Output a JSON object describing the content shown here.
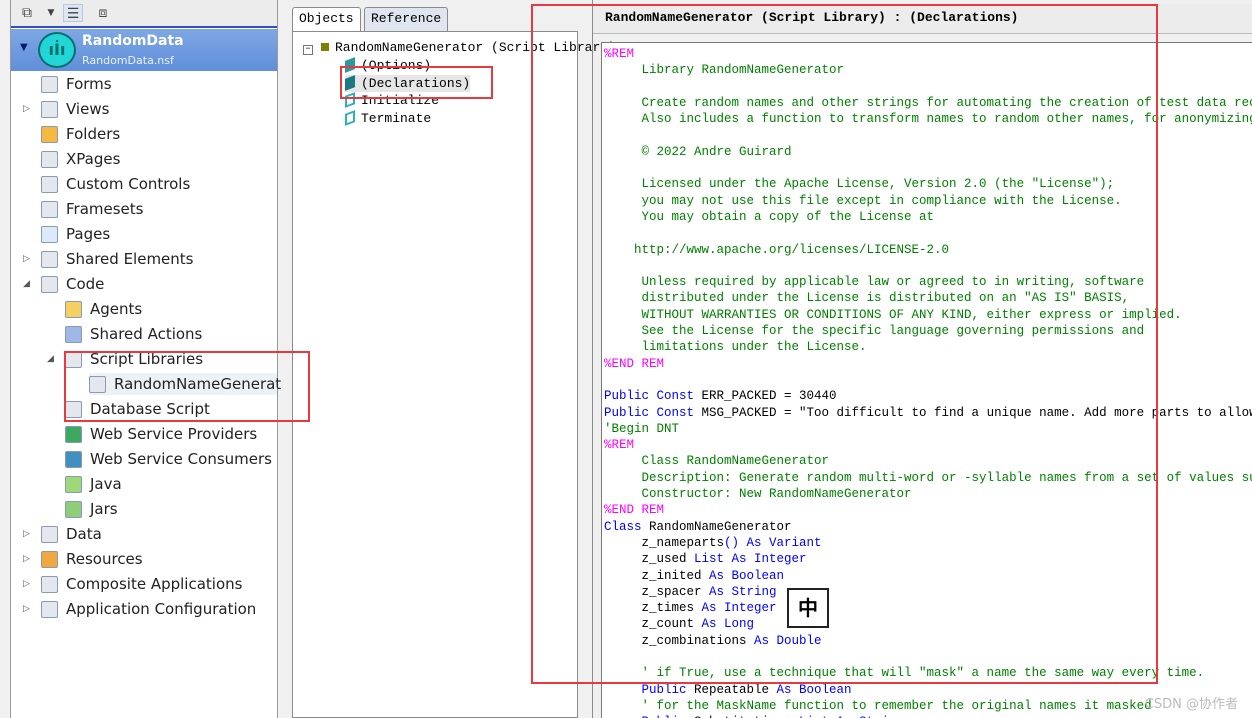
{
  "colors": {
    "comment": "#008000",
    "directive": "#ff00ff",
    "keyword": "#0000ff",
    "text": "#000000",
    "accent": "#e8393f"
  },
  "nav": {
    "toolbar_icons": [
      "new-design-element-icon",
      "dropdown-icon",
      "tree-view-icon",
      "window-icon"
    ],
    "db": {
      "title": "RandomData",
      "file": "RandomData.nsf"
    },
    "items": [
      {
        "label": "Forms",
        "icon": "forms-icon",
        "level": 1,
        "tw": ""
      },
      {
        "label": "Views",
        "icon": "views-icon",
        "level": 1,
        "tw": "▷"
      },
      {
        "label": "Folders",
        "icon": "folder-icon",
        "level": 1,
        "tw": ""
      },
      {
        "label": "XPages",
        "icon": "xpages-icon",
        "level": 1,
        "tw": ""
      },
      {
        "label": "Custom Controls",
        "icon": "custom-controls-icon",
        "level": 1,
        "tw": ""
      },
      {
        "label": "Framesets",
        "icon": "framesets-icon",
        "level": 1,
        "tw": ""
      },
      {
        "label": "Pages",
        "icon": "pages-icon",
        "level": 1,
        "tw": ""
      },
      {
        "label": "Shared Elements",
        "icon": "shared-elements-icon",
        "level": 1,
        "tw": "▷"
      },
      {
        "label": "Code",
        "icon": "code-icon",
        "level": 1,
        "tw": "◢"
      },
      {
        "label": "Agents",
        "icon": "agents-icon",
        "level": 2,
        "tw": ""
      },
      {
        "label": "Shared Actions",
        "icon": "shared-actions-icon",
        "level": 2,
        "tw": ""
      },
      {
        "label": "Script Libraries",
        "icon": "script-libraries-icon",
        "level": 2,
        "tw": "◢"
      },
      {
        "label": "RandomNameGenerat",
        "icon": "script-icon",
        "level": 3,
        "tw": "",
        "selected": true
      },
      {
        "label": "Database Script",
        "icon": "database-script-icon",
        "level": 2,
        "tw": ""
      },
      {
        "label": "Web Service Providers",
        "icon": "web-service-providers-icon",
        "level": 2,
        "tw": ""
      },
      {
        "label": "Web Service Consumers",
        "icon": "web-service-consumers-icon",
        "level": 2,
        "tw": ""
      },
      {
        "label": "Java",
        "icon": "java-icon",
        "level": 2,
        "tw": ""
      },
      {
        "label": "Jars",
        "icon": "jars-icon",
        "level": 2,
        "tw": ""
      },
      {
        "label": "Data",
        "icon": "data-icon",
        "level": 1,
        "tw": "▷"
      },
      {
        "label": "Resources",
        "icon": "resources-icon",
        "level": 1,
        "tw": "▷"
      },
      {
        "label": "Composite Applications",
        "icon": "composite-applications-icon",
        "level": 1,
        "tw": "▷"
      },
      {
        "label": "Application Configuration",
        "icon": "application-configuration-icon",
        "level": 1,
        "tw": "▷"
      }
    ]
  },
  "objects": {
    "tabs": [
      "Objects",
      "Reference"
    ],
    "root": "RandomNameGenerator (Script Library)",
    "children": [
      "(Options)",
      "(Declarations)",
      "Initialize",
      "Terminate"
    ]
  },
  "editor": {
    "title": "RandomNameGenerator (Script Library) : (Declarations)",
    "lines": [
      [
        {
          "t": "%REM",
          "c": "directive"
        }
      ],
      [
        {
          "t": "     Library RandomNameGenerator",
          "c": "comment"
        }
      ],
      [],
      [
        {
          "t": "     Create random names and other strings for automating the creation of test data rec",
          "c": "comment"
        }
      ],
      [
        {
          "t": "     Also includes a function to transform names to random other names, for anonymizing",
          "c": "comment"
        }
      ],
      [],
      [
        {
          "t": "     © 2022 Andre Guirard",
          "c": "comment"
        }
      ],
      [],
      [
        {
          "t": "     Licensed under the Apache License, Version 2.0 (the \"License\");",
          "c": "comment"
        }
      ],
      [
        {
          "t": "     you may not use this file except in compliance with the License.",
          "c": "comment"
        }
      ],
      [
        {
          "t": "     You may obtain a copy of the License at",
          "c": "comment"
        }
      ],
      [],
      [
        {
          "t": "    http://www.apache.org/licenses/LICENSE-2.0",
          "c": "comment"
        }
      ],
      [],
      [
        {
          "t": "     Unless required by applicable law or agreed to in writing, software",
          "c": "comment"
        }
      ],
      [
        {
          "t": "     distributed under the License is distributed on an \"AS IS\" BASIS,",
          "c": "comment"
        }
      ],
      [
        {
          "t": "     WITHOUT WARRANTIES OR CONDITIONS OF ANY KIND, either express or implied.",
          "c": "comment"
        }
      ],
      [
        {
          "t": "     See the License for the specific language governing permissions and",
          "c": "comment"
        }
      ],
      [
        {
          "t": "     limitations under the License.",
          "c": "comment"
        }
      ],
      [
        {
          "t": "%END REM",
          "c": "directive"
        }
      ],
      [],
      [
        {
          "t": "Public Const",
          "c": "keyword"
        },
        {
          "t": " ERR_PACKED = 30440",
          "c": "text"
        }
      ],
      [
        {
          "t": "Public Const",
          "c": "keyword"
        },
        {
          "t": " MSG_PACKED = \"Too difficult to find a unique name. Add more parts to allow",
          "c": "text"
        }
      ],
      [
        {
          "t": "'Begin DNT",
          "c": "comment"
        }
      ],
      [
        {
          "t": "%REM",
          "c": "directive"
        }
      ],
      [
        {
          "t": "     Class RandomNameGenerator",
          "c": "comment"
        }
      ],
      [
        {
          "t": "     Description: Generate random multi-word or -syllable names from a set of values su",
          "c": "comment"
        }
      ],
      [
        {
          "t": "     Constructor: New RandomNameGenerator",
          "c": "comment"
        }
      ],
      [
        {
          "t": "%END REM",
          "c": "directive"
        }
      ],
      [
        {
          "t": "Class",
          "c": "keyword"
        },
        {
          "t": " RandomNameGenerator",
          "c": "text"
        }
      ],
      [
        {
          "t": "     z_nameparts",
          "c": "text"
        },
        {
          "t": "() As Variant",
          "c": "keyword"
        }
      ],
      [
        {
          "t": "     z_used ",
          "c": "text"
        },
        {
          "t": "List As Integer",
          "c": "keyword"
        }
      ],
      [
        {
          "t": "     z_inited ",
          "c": "text"
        },
        {
          "t": "As Boolean",
          "c": "keyword"
        }
      ],
      [
        {
          "t": "     z_spacer ",
          "c": "text"
        },
        {
          "t": "As String",
          "c": "keyword"
        }
      ],
      [
        {
          "t": "     z_times ",
          "c": "text"
        },
        {
          "t": "As Integer",
          "c": "keyword"
        }
      ],
      [
        {
          "t": "     z_count ",
          "c": "text"
        },
        {
          "t": "As Long",
          "c": "keyword"
        }
      ],
      [
        {
          "t": "     z_combinations ",
          "c": "text"
        },
        {
          "t": "As Double",
          "c": "keyword"
        }
      ],
      [],
      [
        {
          "t": "     ' if True, use a technique that will \"mask\" a name the same way every time.",
          "c": "comment"
        }
      ],
      [
        {
          "t": "     Public",
          "c": "keyword"
        },
        {
          "t": " Repeatable ",
          "c": "text"
        },
        {
          "t": "As Boolean",
          "c": "keyword"
        }
      ],
      [
        {
          "t": "     ' for the MaskName function to remember the original names it masked",
          "c": "comment"
        }
      ],
      [
        {
          "t": "     Public",
          "c": "keyword"
        },
        {
          "t": " Substitutions ",
          "c": "text"
        },
        {
          "t": "List As String",
          "c": "keyword"
        }
      ]
    ]
  },
  "ime": {
    "label": "中"
  },
  "watermark": "CSDN @协作者"
}
